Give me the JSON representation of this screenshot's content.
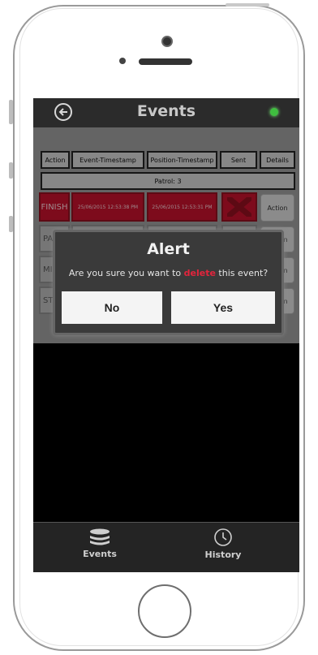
{
  "header": {
    "title": "Events"
  },
  "table": {
    "columns": [
      "Action",
      "Event-Timestamp",
      "Position-Timestamp",
      "Sent",
      "Details"
    ],
    "group_label": "Patrol: 3",
    "rows": [
      {
        "action": "FINISH",
        "event_ts": "25/06/2015 12:53:38 PM",
        "position_ts": "25/06/2015 12:53:31 PM",
        "sent": "not-sent",
        "details_button": "Action"
      },
      {
        "action": "PA",
        "event_ts": "",
        "position_ts": "",
        "sent": "sent",
        "details_button": "Action"
      },
      {
        "action": "MIS",
        "event_ts": "",
        "position_ts": "",
        "sent": "sent",
        "details_button": "Action"
      },
      {
        "action": "STA",
        "event_ts": "",
        "position_ts": "",
        "sent": "sent",
        "details_button": "Action"
      }
    ]
  },
  "dialog": {
    "title": "Alert",
    "message_before": "Are you sure you want to ",
    "message_highlight": "delete",
    "message_after": " this event?",
    "no_label": "No",
    "yes_label": "Yes"
  },
  "tabbar": {
    "tabs": [
      {
        "label": "Events",
        "icon": "database-icon"
      },
      {
        "label": "History",
        "icon": "clock-icon"
      }
    ]
  },
  "colors": {
    "accent_red": "#c0122b",
    "delete_word": "#e2243c",
    "status_dot": "#3fbf3f"
  }
}
